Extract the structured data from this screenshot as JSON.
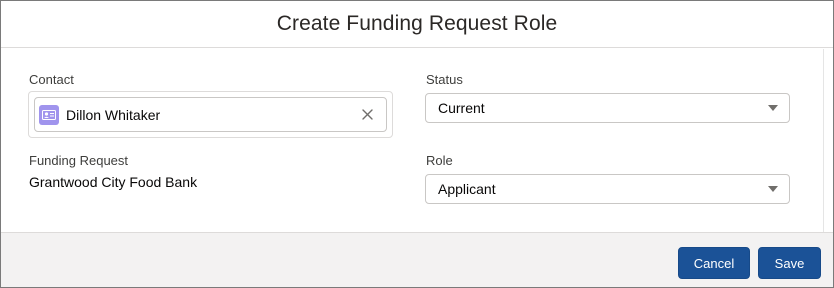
{
  "modal": {
    "title": "Create Funding Request Role"
  },
  "form": {
    "contact": {
      "label": "Contact",
      "value": "Dillon Whitaker"
    },
    "funding_request": {
      "label": "Funding Request",
      "value": "Grantwood City Food Bank"
    },
    "status": {
      "label": "Status",
      "value": "Current"
    },
    "role": {
      "label": "Role",
      "value": "Applicant"
    }
  },
  "footer": {
    "cancel_label": "Cancel",
    "save_label": "Save"
  },
  "icons": {
    "contact": "contact-card-icon",
    "remove": "close-icon",
    "dropdown": "chevron-down-icon"
  },
  "colors": {
    "brand_button": "#1b5297",
    "contact_icon": "#a094ed",
    "footer_bg": "#f3f2f2"
  }
}
